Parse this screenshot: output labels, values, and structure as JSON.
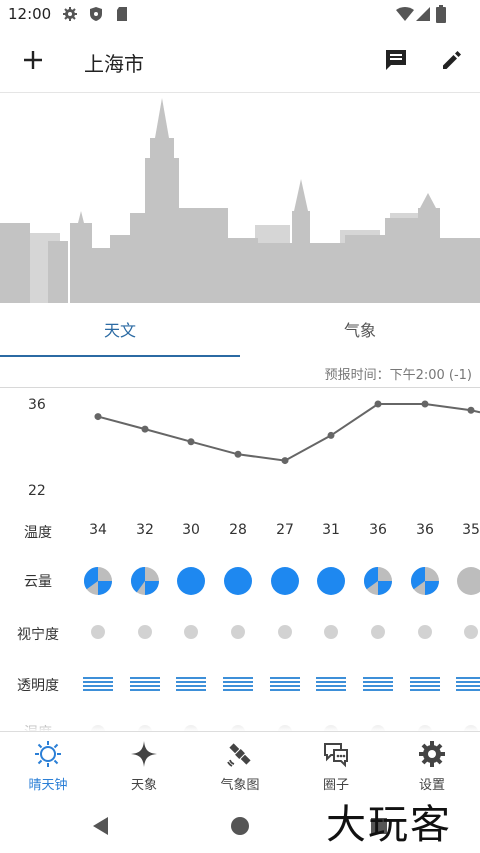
{
  "status": {
    "time": "12:00"
  },
  "header": {
    "title": "上海市"
  },
  "tabs": [
    {
      "label": "天文"
    },
    {
      "label": "气象"
    }
  ],
  "forecast_time": "预报时间：下午2:00 (-1)",
  "chart": {
    "ymax_label": "36",
    "ymin_label": "22",
    "temps": [
      34,
      32,
      30,
      28,
      27,
      31,
      36,
      36,
      35
    ]
  },
  "rows": {
    "temperature": {
      "label": "温度",
      "values": [
        "34",
        "32",
        "30",
        "28",
        "27",
        "31",
        "36",
        "36",
        "35"
      ]
    },
    "cloud": {
      "label": "云量",
      "fractions": [
        0.35,
        0.4,
        1,
        1,
        1,
        1,
        0.35,
        0.35,
        0
      ]
    },
    "seeing": {
      "label": "视宁度"
    },
    "transparency": {
      "label": "透明度"
    },
    "humidity": {
      "label": "湿度"
    }
  },
  "nav": [
    {
      "label": "晴天钟",
      "icon": "sun-icon"
    },
    {
      "label": "天象",
      "icon": "star-sparkle-icon"
    },
    {
      "label": "气象图",
      "icon": "satellite-icon"
    },
    {
      "label": "圈子",
      "icon": "chat-bubbles-icon"
    },
    {
      "label": "设置",
      "icon": "gear-icon"
    }
  ],
  "colors": {
    "accent": "#2b6aa3",
    "blue": "#1e88f0",
    "grey": "#bdbdbd"
  },
  "watermark": "大玩客"
}
